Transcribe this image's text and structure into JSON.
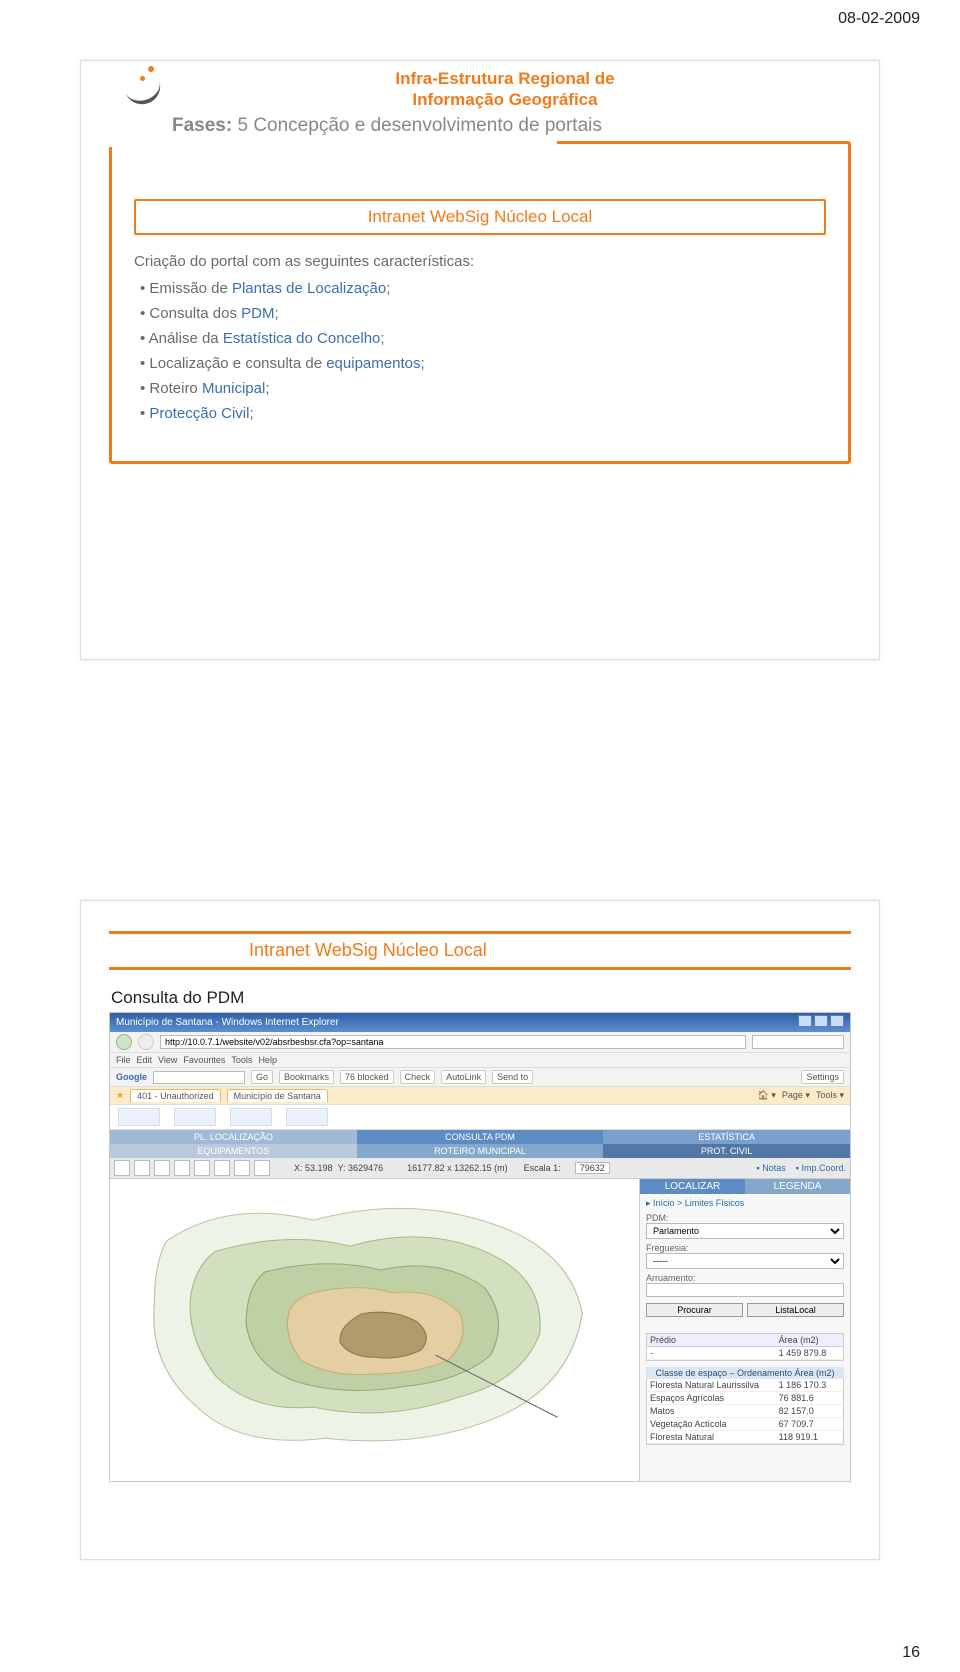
{
  "page": {
    "date": "08-02-2009",
    "number": "16"
  },
  "slide1": {
    "title_line1": "Infra-Estrutura Regional de",
    "title_line2": "Informação Geográfica",
    "phase_label": "Fases:",
    "phase_text": " 5 Concepção e desenvolvimento de portais",
    "subtitle": "Intranet WebSig Núcleo Local",
    "lead": "Criação do portal com as seguintes características:",
    "bullets": [
      {
        "plain": "Emissão de ",
        "link": "Plantas de Localização",
        "tail": ";"
      },
      {
        "plain": "Consulta dos ",
        "link": "PDM",
        "tail": ";"
      },
      {
        "plain": "Análise da ",
        "link": "Estatística do Concelho",
        "tail": ";"
      },
      {
        "plain": "Localização e consulta de ",
        "link": "equipamentos",
        "tail": ";"
      },
      {
        "plain": "Roteiro ",
        "link": "Municipal",
        "tail": ";"
      },
      {
        "plain": "",
        "link": "Protecção Civil",
        "tail": ";"
      }
    ]
  },
  "slide2": {
    "header": "Intranet WebSig Núcleo Local",
    "sub": "Consulta do PDM",
    "screenshot": {
      "window_title": "Município de Santana - Windows Internet Explorer",
      "url": "http://10.0.7.1/website/v02/absrbesbsr.cfa?op=santana",
      "menus": [
        "File",
        "Edit",
        "View",
        "Favourites",
        "Tools",
        "Help"
      ],
      "google_toolbar": {
        "go": "Go",
        "bookmarks": "Bookmarks",
        "blocked": "76 blocked",
        "check": "Check",
        "autolink": "AutoLink",
        "sendto": "Send to",
        "settings": "Settings"
      },
      "tabs": [
        "401 - Unauthorized",
        "Município de Santana"
      ],
      "right_tools": [
        "Page",
        "Tools"
      ],
      "page_menu": {
        "items": [
          "PL. LOCALIZAÇÃO",
          "CONSULTA PDM",
          "ESTATÍSTICA",
          "EQUIPAMENTOS",
          "ROTEIRO MUNICIPAL",
          "PROT. CIVIL"
        ]
      },
      "coords": {
        "x": "X: 53.198",
        "y": "Y: 3629476",
        "size": "16177.82 x 13262.15 (m)",
        "scale_label": "Escala 1:",
        "scale": "79632",
        "notes": "Notas",
        "printcoord": "Imp.Coord."
      },
      "legend_hdr": "LEGENDA",
      "localizar_hdr": "LOCALIZAR",
      "breadcrumb": "Início > Limites Físicos",
      "form": {
        "pdm_label": "PDM:",
        "pdm_value": "Parlamento",
        "freg_label": "Freguesia:",
        "freg_value": "-----",
        "arr_label": "Arruamento:",
        "arr_value": "",
        "btn_procurar": "Procurar",
        "btn_listalocal": "ListaLocal"
      },
      "predio_table": {
        "headers": [
          "Prédio",
          "Área (m2)"
        ],
        "rows": [
          [
            "-",
            "1 459 879.8"
          ]
        ]
      },
      "classe_header": "Classe de espaço – Ordenamento    Área (m2)",
      "classe_rows": [
        [
          "Floresta Natural Laurissilva",
          "1 186 170.3"
        ],
        [
          "Espaços Agrícolas",
          "76 881.6"
        ],
        [
          "Matos",
          "82 157.0"
        ],
        [
          "Vegetação Actícola",
          "67 709.7"
        ],
        [
          "Floresta Natural",
          "118 919.1"
        ]
      ]
    }
  }
}
